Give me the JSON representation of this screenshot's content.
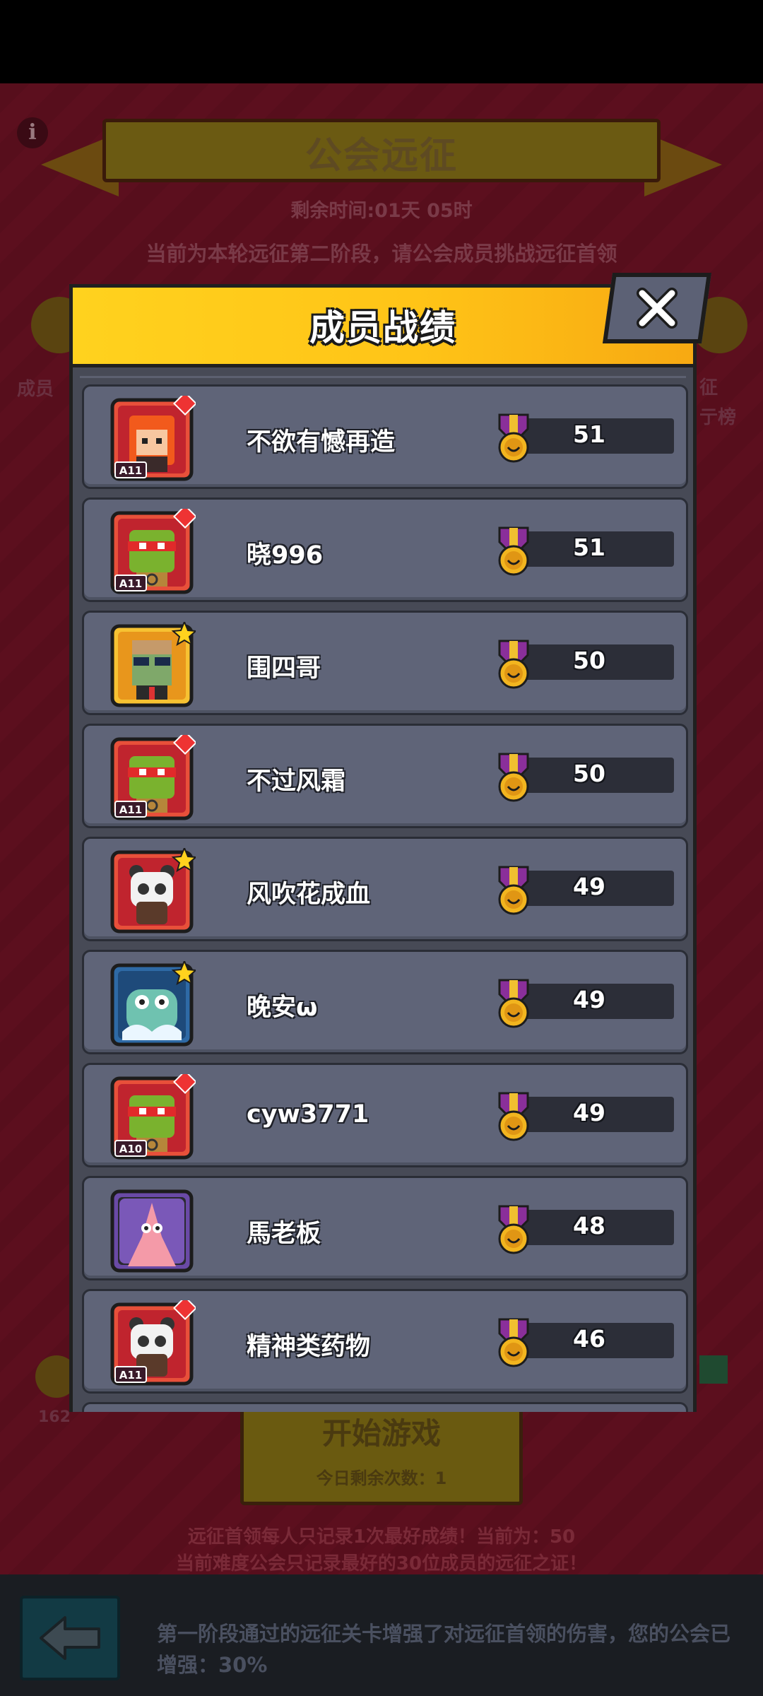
{
  "background": {
    "title": "公会远征",
    "time_remaining": "剩余时间:01天 05时",
    "stage_text": "当前为本轮远征第二阶段，请公会成员挑战远征首领",
    "left_side_label": "成员",
    "right_side_label": "征 亍榜",
    "left_number": "162",
    "start_button_label": "开始游戏",
    "remaining_attempts": "今日剩余次数：1",
    "note_line1": "远征首领每人只记录1次最好成绩！当前为：50",
    "note_line2": "当前难度公会只记录最好的30位成员的远征之证！",
    "bottom_message": "第一阶段通过的远征关卡增强了对远征首领的伤害，您的公会已增强：30%"
  },
  "modal": {
    "title": "成员战绩",
    "members": [
      {
        "name": "不欲有憾再造",
        "score": "51",
        "avatar": "orange-hair-girl-avatar",
        "badge": "A11"
      },
      {
        "name": "晓996",
        "score": "51",
        "avatar": "ninja-turtle-avatar",
        "badge": "A11"
      },
      {
        "name": "围四哥",
        "score": "50",
        "avatar": "sunglasses-zombie-avatar",
        "badge": ""
      },
      {
        "name": "不过风霜",
        "score": "50",
        "avatar": "ninja-turtle-avatar",
        "badge": "A11"
      },
      {
        "name": "风吹花成血",
        "score": "49",
        "avatar": "panda-avatar",
        "badge": ""
      },
      {
        "name": "晚安ω",
        "score": "49",
        "avatar": "ice-monster-avatar",
        "badge": ""
      },
      {
        "name": "cyw3771",
        "score": "49",
        "avatar": "ninja-turtle-avatar",
        "badge": "A10"
      },
      {
        "name": "馬老板",
        "score": "48",
        "avatar": "starfish-avatar",
        "badge": ""
      },
      {
        "name": "精神类药物",
        "score": "46",
        "avatar": "panda-avatar",
        "badge": "A11"
      }
    ]
  },
  "colors": {
    "header_yellow": "#ffc417",
    "row_bg": "#5f6478",
    "body_bg": "#474a56",
    "medal_gold": "#f2b51f",
    "medal_ribbon": "#8a2f9a"
  }
}
